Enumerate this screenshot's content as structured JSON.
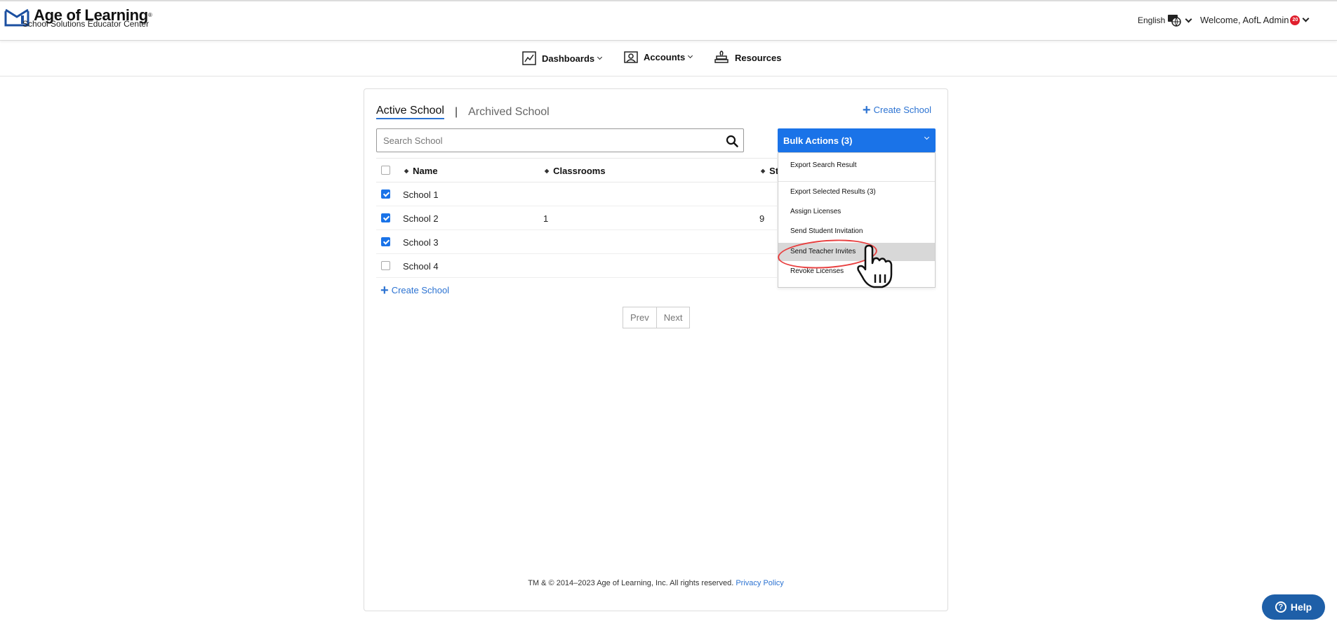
{
  "header": {
    "brand_title": "Age of Learning",
    "brand_mark": "®",
    "brand_subtitle": "School Solutions Educator Center",
    "language": "English",
    "welcome": "Welcome, AofL Admin",
    "notification_count": "20"
  },
  "nav": {
    "items": [
      {
        "label": "Dashboards",
        "icon": "chart-icon"
      },
      {
        "label": "Accounts",
        "icon": "accounts-icon"
      },
      {
        "label": "Resources",
        "icon": "resources-icon"
      }
    ]
  },
  "tabs": {
    "active": "Active School",
    "separator": "|",
    "archived": "Archived School"
  },
  "create_school_label": "Create School",
  "search": {
    "placeholder": "Search School"
  },
  "bulk_actions": {
    "label": "Bulk Actions (3)",
    "items": [
      "Export Search Result",
      "Export Selected Results (3)",
      "Assign Licenses",
      "Send Student Invitation",
      "Send Teacher Invites",
      "Revoke Licenses"
    ],
    "highlighted": "Send Teacher Invites"
  },
  "table": {
    "columns": [
      "Name",
      "Classrooms",
      "St"
    ],
    "rows": [
      {
        "name": "School 1",
        "classrooms": "",
        "students": "",
        "checked": true
      },
      {
        "name": "School 2",
        "classrooms": "1",
        "students": "9",
        "checked": true
      },
      {
        "name": "School 3",
        "classrooms": "",
        "students": "",
        "checked": true
      },
      {
        "name": "School 4",
        "classrooms": "",
        "students": "",
        "checked": false
      }
    ]
  },
  "pager": {
    "prev": "Prev",
    "next": "Next"
  },
  "footer": {
    "text": "TM & © 2014–2023 Age of Learning, Inc. All rights reserved.",
    "link": "Privacy Policy"
  },
  "help": {
    "label": "Help",
    "icon_glyph": "?"
  },
  "colors": {
    "accent": "#1a73e8",
    "link": "#2c73d2",
    "help": "#1e5fa8",
    "ring": "#e84040",
    "badge": "#e01f2d"
  }
}
